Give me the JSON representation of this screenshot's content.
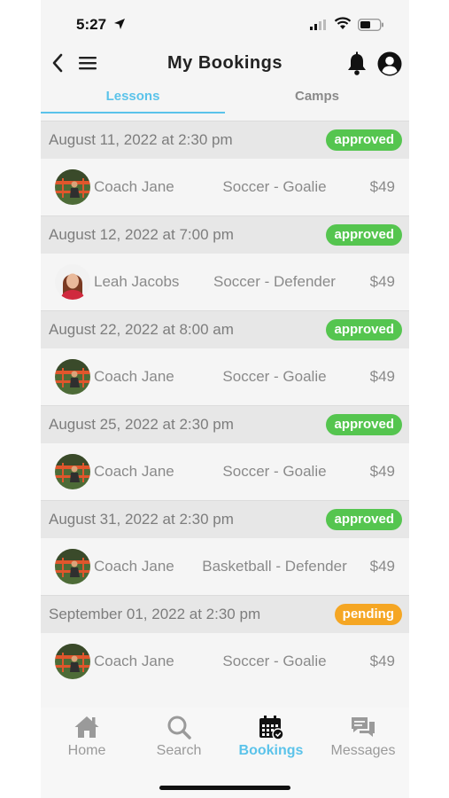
{
  "status_bar": {
    "time": "5:27"
  },
  "header": {
    "title": "My Bookings"
  },
  "tabs": [
    {
      "label": "Lessons",
      "active": true
    },
    {
      "label": "Camps",
      "active": false
    }
  ],
  "bookings": [
    {
      "date": "August 11, 2022 at 2:30 pm",
      "status": "approved",
      "coach": "Coach Jane",
      "session": "Soccer - Goalie",
      "price": "$49",
      "avatar": "coach-jane"
    },
    {
      "date": "August 12, 2022 at 7:00 pm",
      "status": "approved",
      "coach": "Leah Jacobs",
      "session": "Soccer - Defender",
      "price": "$49",
      "avatar": "leah-jacobs"
    },
    {
      "date": "August 22, 2022 at 8:00 am",
      "status": "approved",
      "coach": "Coach Jane",
      "session": "Soccer - Goalie",
      "price": "$49",
      "avatar": "coach-jane"
    },
    {
      "date": "August 25, 2022 at 2:30 pm",
      "status": "approved",
      "coach": "Coach Jane",
      "session": "Soccer - Goalie",
      "price": "$49",
      "avatar": "coach-jane"
    },
    {
      "date": "August 31, 2022 at 2:30 pm",
      "status": "approved",
      "coach": "Coach Jane",
      "session": "Basketball - Defender",
      "price": "$49",
      "avatar": "coach-jane"
    },
    {
      "date": "September 01, 2022 at 2:30 pm",
      "status": "pending",
      "coach": "Coach Jane",
      "session": "Soccer - Goalie",
      "price": "$49",
      "avatar": "coach-jane"
    }
  ],
  "bottom_nav": [
    {
      "label": "Home",
      "icon": "home-icon",
      "active": false
    },
    {
      "label": "Search",
      "icon": "search-icon",
      "active": false
    },
    {
      "label": "Bookings",
      "icon": "calendar-icon",
      "active": true
    },
    {
      "label": "Messages",
      "icon": "messages-icon",
      "active": false
    }
  ],
  "colors": {
    "accent": "#5bc3ea",
    "approved": "#55c54f",
    "pending": "#f5a623",
    "row_header_bg": "#e7e7e7",
    "row_bg": "#f5f5f5"
  }
}
